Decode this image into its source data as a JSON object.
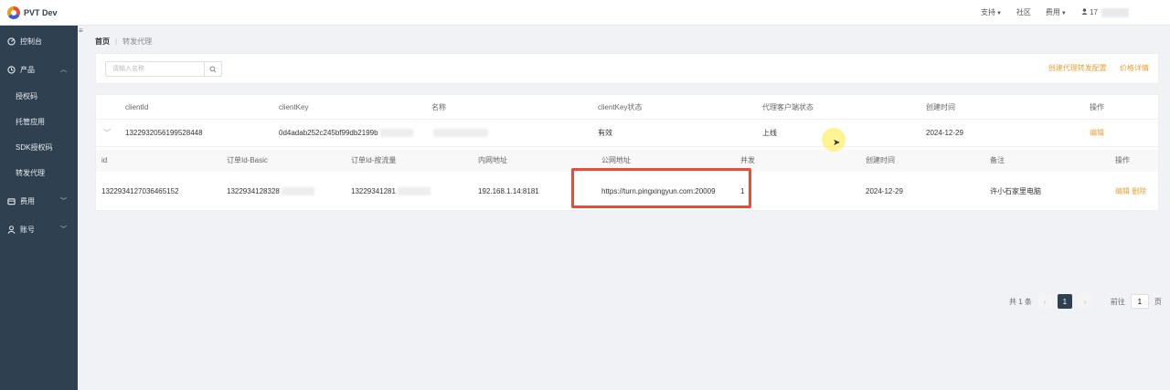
{
  "app": {
    "title": "PVT Dev"
  },
  "topnav": {
    "support": "支持",
    "community": "社区",
    "fees": "费用",
    "user": "17"
  },
  "sidebar": {
    "items": [
      {
        "label": "控制台",
        "icon": "dashboard-icon"
      },
      {
        "label": "产品",
        "icon": "clock-icon"
      },
      {
        "label": "费用",
        "icon": "wallet-icon"
      },
      {
        "label": "账号",
        "icon": "user-icon"
      }
    ],
    "product_sub": [
      "授权码",
      "托管应用",
      "SDK授权码",
      "转发代理"
    ]
  },
  "breadcrumb": {
    "home": "首页",
    "current": "转发代理"
  },
  "filter": {
    "search_placeholder": "请输入名称",
    "link_create": "创建代理转发配置",
    "link_price": "价格详情"
  },
  "table": {
    "columns": [
      "clientId",
      "clientKey",
      "名称",
      "clientKey状态",
      "代理客户端状态",
      "创建时间",
      "操作"
    ],
    "row": {
      "clientId": "1322932056199528448",
      "clientKey": "0d4adab252c245bf99db2199b",
      "name": "",
      "key_status": "有效",
      "client_status": "上线",
      "created": "2024-12-29",
      "action": "编辑"
    },
    "sub_columns": [
      "id",
      "订单Id-Basic",
      "订单Id-按流量",
      "内网地址",
      "公网地址",
      "并发",
      "创建时间",
      "备注",
      "操作"
    ],
    "sub_row": {
      "id": "1322934127036465152",
      "order_basic": "1322934128328",
      "order_flow": "13229341281",
      "lan": "192.168.1.14:8181",
      "public": "https://turn.pingxingyun.com:20009",
      "concurrency": "1",
      "created": "2024-12-29",
      "remark": "许小石家里电脑",
      "edit": "编辑",
      "delete": "删除"
    }
  },
  "pagination": {
    "total": "共 1 条",
    "current": "1",
    "goto": "前往",
    "goto_value": "1",
    "page_unit": "页"
  }
}
